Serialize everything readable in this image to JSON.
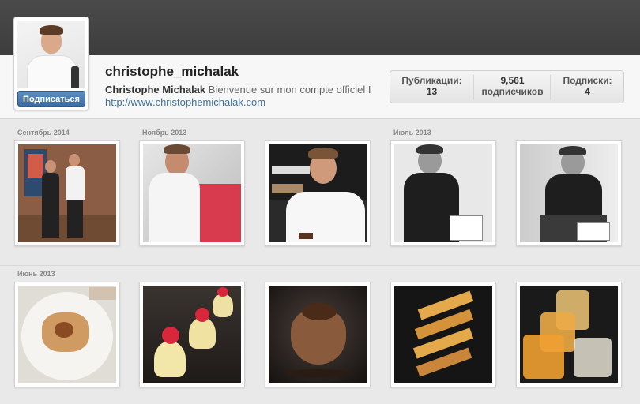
{
  "profile": {
    "username": "christophe_michalak",
    "full_name": "Christophe Michalak",
    "bio": "Bienvenue sur mon compte officiel I",
    "website": "http://www.christophemichalak.com",
    "follow_label": "Подписаться"
  },
  "stats": {
    "posts_label": "Публикации:",
    "posts_value": "13",
    "followers_value": "9,561",
    "followers_label": "подписчиков",
    "following_label": "Подписки:",
    "following_value": "4"
  },
  "groups": [
    {
      "date_1": "Сентябрь 2014",
      "date_2": "Ноябрь 2013",
      "date_3": "Июль 2013"
    },
    {
      "date_1": "Июнь 2013"
    }
  ],
  "photos": [
    {
      "icon": "photo-two-chefs-kitchen"
    },
    {
      "icon": "photo-chef-writing"
    },
    {
      "icon": "photo-chef-tasting-chocolate"
    },
    {
      "icon": "photo-bw-leather-jacket"
    },
    {
      "icon": "photo-bw-seated-jacket"
    },
    {
      "icon": "photo-plated-dessert"
    },
    {
      "icon": "photo-cream-puffs"
    },
    {
      "icon": "photo-chocolate-heart"
    },
    {
      "icon": "photo-pastry-stack"
    },
    {
      "icon": "photo-glass-desserts"
    }
  ],
  "colors": {
    "topbar": "#3d3d3d",
    "follow_button": "#3c6ea3",
    "link": "#3f729b"
  }
}
